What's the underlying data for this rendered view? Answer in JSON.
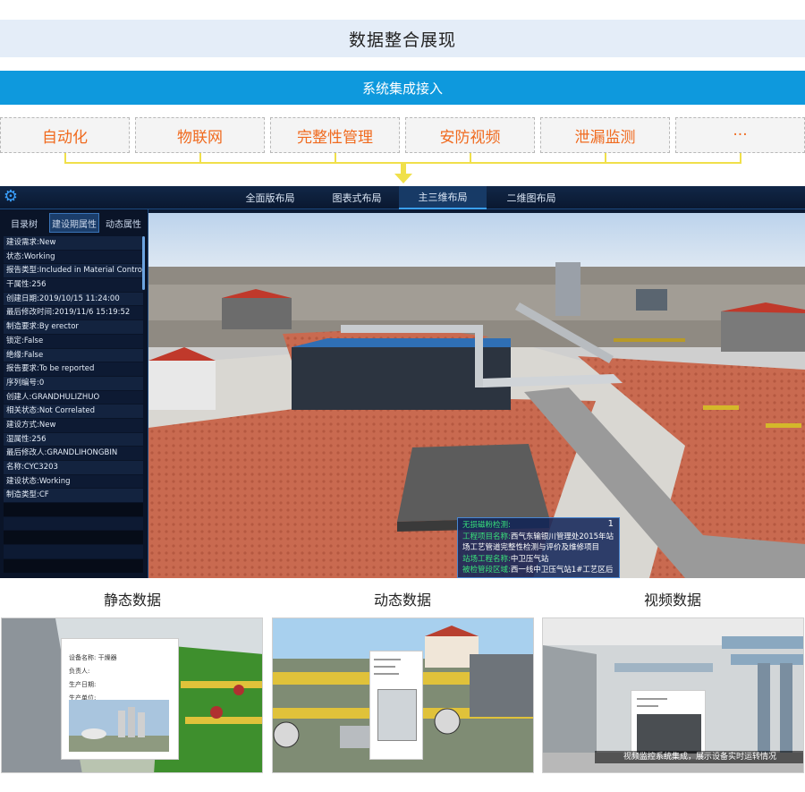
{
  "title": "数据整合展现",
  "integration_label": "系统集成接入",
  "categories": [
    "自动化",
    "物联网",
    "完整性管理",
    "安防视频",
    "泄漏监测",
    "···"
  ],
  "app": {
    "layout_tabs": [
      "全面版布局",
      "图表式布局",
      "主三维布局",
      "二维图布局"
    ],
    "active_layout_tab": "主三维布局",
    "side_tabs": [
      "目录树",
      "建设期属性",
      "动态属性"
    ],
    "active_side_tab": "建设期属性",
    "properties": [
      "建设需求:New",
      "状态:Working",
      "报告类型:Included in Material Control System",
      "干属性:256",
      "创建日期:2019/10/15 11:24:00",
      "最后修改时间:2019/11/6 15:19:52",
      "制造要求:By erector",
      "锁定:False",
      "绝缘:False",
      "报告要求:To be reported",
      "序列编号:0",
      "创建人:GRANDHULIZHUO",
      "相关状态:Not Correlated",
      "建设方式:New",
      "湿属性:256",
      "最后修改人:GRANDLIHONGBIN",
      "名称:CYC3203",
      "建设状态:Working",
      "制造类型:CF"
    ],
    "popup": {
      "close": "1",
      "line1": "无损磁粉检测:",
      "line2_label": "工程项目名称:",
      "line2_value": "西气东输银川管理处2015年站场工艺管道完整性检测与评价及维修项目",
      "line3_label": "站场工程名称:",
      "line3_value": "中卫压气站",
      "line4_label": "被检管段区域:",
      "line4_value": "西一线中卫压气站1#工艺区后"
    }
  },
  "sections": [
    "静态数据",
    "动态数据",
    "视频数据"
  ],
  "static_card": {
    "rows": [
      "设备名称:  干燥器",
      "负责人:",
      "生产日期:",
      "生产单位:"
    ]
  },
  "video_caption": "视频监控系统集成，展示设备实时运转情况",
  "colors": {
    "accent_blue": "#0e99dd",
    "category_orange": "#f06a1e",
    "connector_yellow": "#f0e04a"
  }
}
